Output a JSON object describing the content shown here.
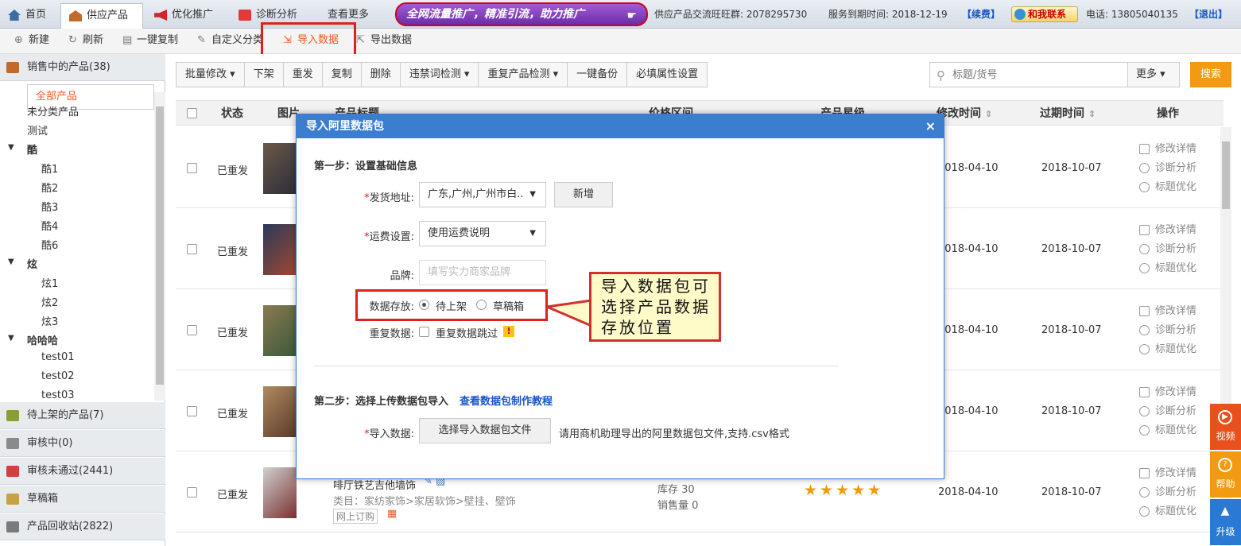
{
  "topbar": {
    "tabs": [
      {
        "label": "首页",
        "icon": "home-icon"
      },
      {
        "label": "供应产品",
        "icon": "product-icon"
      },
      {
        "label": "优化推广",
        "icon": "megaphone-icon"
      },
      {
        "label": "诊断分析",
        "icon": "medical-kit-icon"
      },
      {
        "label": "查看更多"
      }
    ],
    "promo": "全网流量推广，精准引流，助力推广",
    "group_info": "供应产品交流旺旺群: 2078295730",
    "service_date": "服务到期时间: 2018-12-19",
    "renew": "【续费】",
    "contact": "和我联系",
    "phone": "电话: 13805040135",
    "logout": "【退出】"
  },
  "toolbar": {
    "new": "新建",
    "refresh": "刷新",
    "copy": "一键复制",
    "custom_cat": "自定义分类",
    "import": "导入数据",
    "export": "导出数据"
  },
  "sidebar": {
    "on_sale": "销售中的产品(38)",
    "tree": [
      {
        "label": "全部产品"
      },
      {
        "label": "未分类产品"
      },
      {
        "label": "测试"
      },
      {
        "label": "酷"
      },
      {
        "label": "酷1"
      },
      {
        "label": "酷2"
      },
      {
        "label": "酷3"
      },
      {
        "label": "酷4"
      },
      {
        "label": "酷6"
      },
      {
        "label": "炫"
      },
      {
        "label": "炫1"
      },
      {
        "label": "炫2"
      },
      {
        "label": "炫3"
      },
      {
        "label": "哈哈哈"
      },
      {
        "label": "test01"
      },
      {
        "label": "test02"
      },
      {
        "label": "test03"
      }
    ],
    "pending": "待上架的产品(7)",
    "review": "审核中(0)",
    "rejected": "审核未通过(2441)",
    "draft": "草稿箱",
    "recycle": "产品回收站(2822)"
  },
  "actions": [
    "批量修改",
    "下架",
    "重发",
    "复制",
    "删除",
    "违禁词检测",
    "重复产品检测",
    "一键备份",
    "必填属性设置"
  ],
  "search": {
    "placeholder": "标题/货号",
    "more": "更多",
    "button": "搜索"
  },
  "table": {
    "headers": {
      "status": "状态",
      "image": "图片",
      "title": "产品标题",
      "price": "价格区间",
      "stars": "产品星级",
      "modified": "修改时间",
      "expire": "过期时间",
      "ops": "操作"
    },
    "rows": [
      {
        "status": "已重发",
        "modified": "2018-04-10",
        "expire": "2018-10-07"
      },
      {
        "status": "已重发",
        "modified": "2018-04-10",
        "expire": "2018-10-07"
      },
      {
        "status": "已重发",
        "modified": "2018-04-10",
        "expire": "2018-10-07"
      },
      {
        "status": "已重发",
        "modified": "2018-04-10",
        "expire": "2018-10-07"
      },
      {
        "status": "已重发",
        "modified": "2018-04-10",
        "expire": "2018-10-07",
        "title": "啡厅铁艺吉他墙饰",
        "category": "类目：家纺家饰>家居软饰>壁挂、壁饰",
        "order_tag": "网上订购",
        "stock": "库存 30",
        "sales": "销售量 0",
        "stars": 5
      }
    ],
    "ops": {
      "edit": "修改详情",
      "diagnose": "诊断分析",
      "optimize": "标题优化"
    }
  },
  "side_float": {
    "video": "视频",
    "help": "帮助",
    "upgrade": "升级"
  },
  "modal": {
    "title": "导入阿里数据包",
    "close": "×",
    "step1": "第一步：设置基础信息",
    "ship_label": "发货地址:",
    "ship_value": "广东,广州,广州市白..",
    "add_btn": "新增",
    "freight_label": "运费设置:",
    "freight_value": "使用运费说明",
    "brand_label": "品牌:",
    "brand_placeholder": "填写实力商家品牌",
    "store_label": "数据存放:",
    "opt_pending": "待上架",
    "opt_draft": "草稿箱",
    "dup_label": "重复数据:",
    "dup_skip": "重复数据跳过",
    "step2": "第二步：选择上传数据包导入",
    "tutorial_link": "查看数据包制作教程",
    "import_label": "导入数据:",
    "choose_file": "选择导入数据包文件",
    "file_hint": "请用商机助理导出的阿里数据包文件,支持.csv格式"
  },
  "callout": {
    "line1": "导入数据包可",
    "line2": "选择产品数据",
    "line3": "存放位置"
  }
}
